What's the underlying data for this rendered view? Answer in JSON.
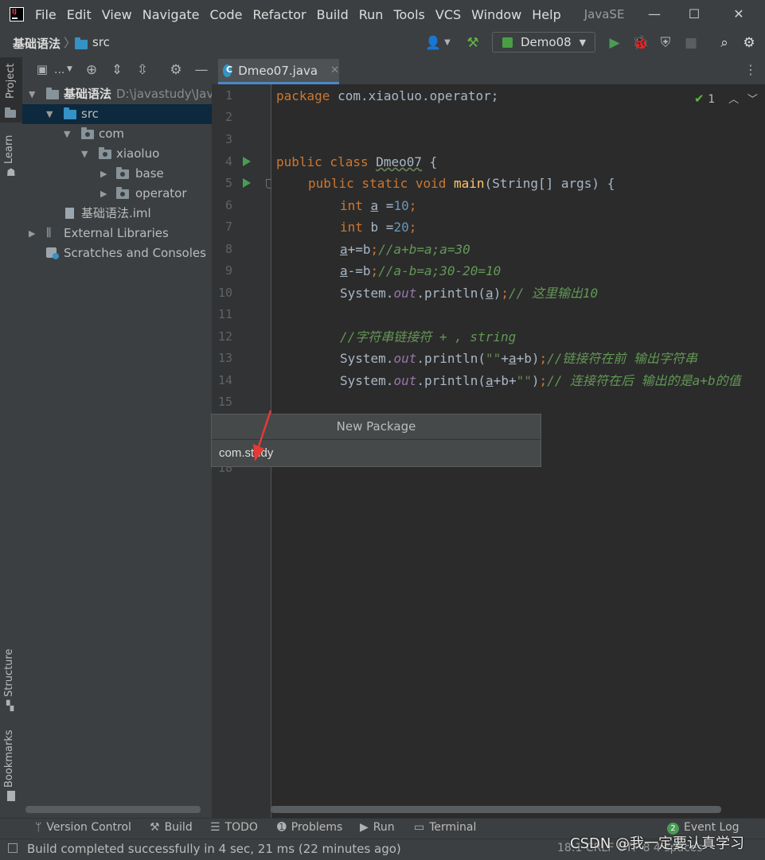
{
  "menu": [
    "File",
    "Edit",
    "View",
    "Navigate",
    "Code",
    "Refactor",
    "Build",
    "Run",
    "Tools",
    "VCS",
    "Window",
    "Help"
  ],
  "window_title": "JavaSE",
  "breadcrumb": {
    "project": "基础语法",
    "folder": "src"
  },
  "run_config": "Demo08",
  "left_tabs": {
    "project": "Project",
    "learn": "Learn",
    "structure": "Structure",
    "bookmarks": "Bookmarks"
  },
  "project_toolbar_label": "...",
  "tree": [
    {
      "label": "基础语法",
      "extra": "D:\\javastudy\\Java"
    },
    {
      "label": "src"
    },
    {
      "label": "com"
    },
    {
      "label": "xiaoluo"
    },
    {
      "label": "base"
    },
    {
      "label": "operator"
    },
    {
      "label": "基础语法.iml"
    },
    {
      "label": "External Libraries"
    },
    {
      "label": "Scratches and Consoles"
    }
  ],
  "editor": {
    "tab": "Dmeo07.java",
    "inspections": "1",
    "line_numbers": [
      "1",
      "2",
      "3",
      "4",
      "5",
      "6",
      "7",
      "8",
      "9",
      "10",
      "11",
      "12",
      "13",
      "14",
      "15",
      "18"
    ],
    "code": {
      "package_kw": "package",
      "package_name": " com.xiaoluo.operator;",
      "class_kw": "public class ",
      "class_name": "Dmeo07",
      "class_end": " {",
      "main_kw": "public static void ",
      "main_fn": "main",
      "main_args": "(String[] args) {",
      "l6_kw": "int ",
      "l6_var": "a",
      "l6_eq": " =",
      "l6_num": "10",
      "l6_end": ";",
      "l7_kw": "int ",
      "l7_var": "b =",
      "l7_num": "20",
      "l7_end": ";",
      "l8_var": "a",
      "l8_op": "+=b",
      "l8_semi": ";",
      "l8_cm": "//a+b=a;a=30",
      "l9_var": "a",
      "l9_op": "-=b",
      "l9_semi": ";",
      "l9_cm": "//a-b=a;30-20=10",
      "l10_a": "System.",
      "l10_out": "out",
      "l10_b": ".println(",
      "l10_var": "a",
      "l10_c": ")",
      "l10_semi": ";",
      "l10_cm": "// 这里输出10",
      "l12_cm": "//字符串链接符 + , string",
      "l13_a": "System.",
      "l13_out": "out",
      "l13_b": ".println(",
      "l13_str": "\"\"",
      "l13_c": "+",
      "l13_var": "a",
      "l13_d": "+b)",
      "l13_semi": ";",
      "l13_cm": "//链接符在前 输出字符串",
      "l14_a": "System.",
      "l14_out": "out",
      "l14_b": ".println(",
      "l14_var": "a",
      "l14_c": "+b+",
      "l14_str": "\"\"",
      "l14_d": ")",
      "l14_semi": ";",
      "l14_cm": "// 连接符在后 输出的是a+b的值"
    }
  },
  "dialog": {
    "title": "New Package",
    "value": "com.study"
  },
  "bottom_tools": [
    "Version Control",
    "Build",
    "TODO",
    "Problems",
    "Run",
    "Terminal"
  ],
  "event_log": {
    "count": "2",
    "label": "Event Log"
  },
  "status": {
    "message": "Build completed successfully in 4 sec, 21 ms (22 minutes ago)",
    "right": "18:1  CRLF  UTF-8  4 spaces"
  },
  "watermark": "CSDN @我一定要认真学习",
  "colors": {
    "keyword": "#cc7832",
    "number": "#6897bb",
    "comment": "#629755",
    "function": "#ffc66d",
    "accent": "#4a88c7",
    "run_green": "#499c54"
  }
}
